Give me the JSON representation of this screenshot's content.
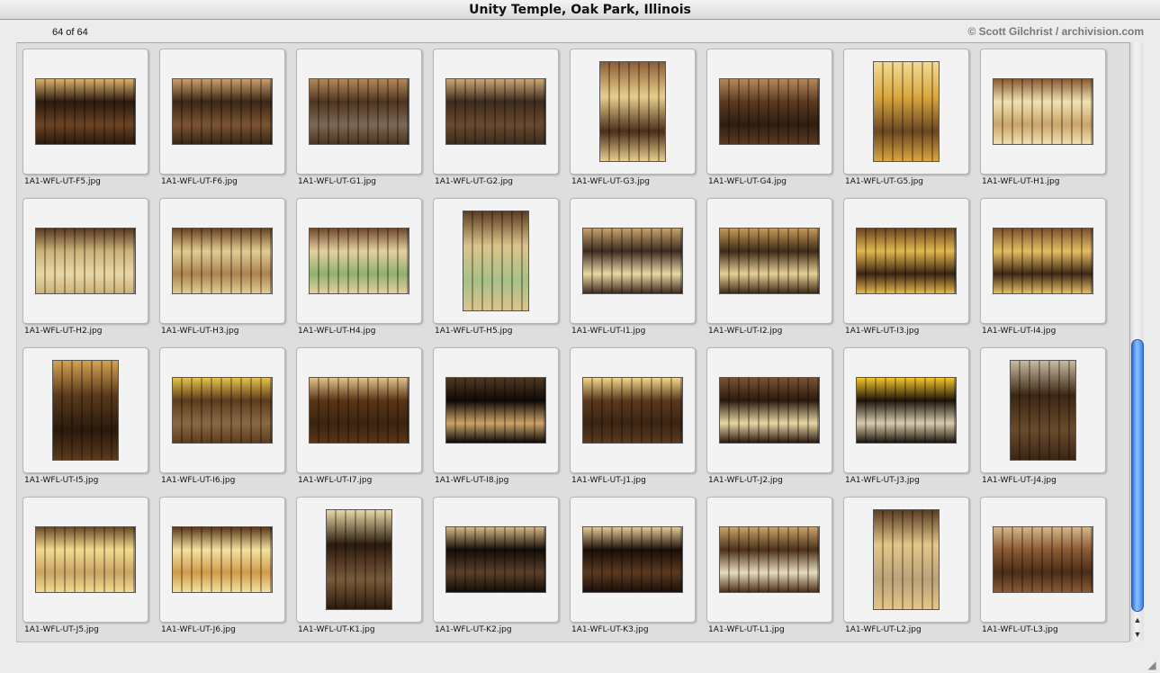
{
  "window": {
    "title": "Unity Temple, Oak Park, Illinois"
  },
  "info": {
    "count": "64 of 64",
    "copyright": "© Scott Gilchrist / archivision.com"
  },
  "thumbnails": [
    {
      "file": "1A1-WFL-UT-F5.jpg",
      "orient": "land",
      "colors": [
        "#2a1a0e",
        "#d9b26a",
        "#6b4424"
      ]
    },
    {
      "file": "1A1-WFL-UT-F6.jpg",
      "orient": "land",
      "colors": [
        "#3a2715",
        "#c8a06a",
        "#7a5533"
      ]
    },
    {
      "file": "1A1-WFL-UT-G1.jpg",
      "orient": "land",
      "colors": [
        "#4e3420",
        "#b28a5a",
        "#7a6a56"
      ]
    },
    {
      "file": "1A1-WFL-UT-G2.jpg",
      "orient": "land",
      "colors": [
        "#3b2b1c",
        "#c9a978",
        "#6a4a30"
      ]
    },
    {
      "file": "1A1-WFL-UT-G3.jpg",
      "orient": "port",
      "colors": [
        "#e8cf8e",
        "#8b5e36",
        "#4b2e18"
      ]
    },
    {
      "file": "1A1-WFL-UT-G4.jpg",
      "orient": "land",
      "colors": [
        "#5a3a20",
        "#b48a5c",
        "#2e1e10"
      ]
    },
    {
      "file": "1A1-WFL-UT-G5.jpg",
      "orient": "port",
      "colors": [
        "#d8a840",
        "#f2dc92",
        "#6a4622"
      ]
    },
    {
      "file": "1A1-WFL-UT-H1.jpg",
      "orient": "land",
      "colors": [
        "#f0e2b0",
        "#8a5a34",
        "#c9a46a"
      ]
    },
    {
      "file": "1A1-WFL-UT-H2.jpg",
      "orient": "land",
      "colors": [
        "#cbb27a",
        "#5a3a22",
        "#e8d8a8"
      ]
    },
    {
      "file": "1A1-WFL-UT-H3.jpg",
      "orient": "land",
      "colors": [
        "#e2cc92",
        "#6a4424",
        "#a98450"
      ]
    },
    {
      "file": "1A1-WFL-UT-H4.jpg",
      "orient": "land",
      "colors": [
        "#e4d0a0",
        "#6e4a2c",
        "#8fb070"
      ]
    },
    {
      "file": "1A1-WFL-UT-H5.jpg",
      "orient": "port",
      "colors": [
        "#dcc48c",
        "#5e3e22",
        "#a6c08a"
      ]
    },
    {
      "file": "1A1-WFL-UT-I1.jpg",
      "orient": "land",
      "colors": [
        "#3c2c1e",
        "#c6a26c",
        "#e8d6a4"
      ]
    },
    {
      "file": "1A1-WFL-UT-I2.jpg",
      "orient": "land",
      "colors": [
        "#3e2a16",
        "#c69a58",
        "#e6cf96"
      ]
    },
    {
      "file": "1A1-WFL-UT-I3.jpg",
      "orient": "land",
      "colors": [
        "#e2b84e",
        "#6a4622",
        "#3a2412"
      ]
    },
    {
      "file": "1A1-WFL-UT-I4.jpg",
      "orient": "land",
      "colors": [
        "#e4be62",
        "#7a5030",
        "#3e2816"
      ]
    },
    {
      "file": "1A1-WFL-UT-I5.jpg",
      "orient": "port",
      "colors": [
        "#5a3a1c",
        "#d4a452",
        "#2a1a0c"
      ]
    },
    {
      "file": "1A1-WFL-UT-I6.jpg",
      "orient": "land",
      "colors": [
        "#5c3c1e",
        "#e6c24a",
        "#8a6a44"
      ]
    },
    {
      "file": "1A1-WFL-UT-I7.jpg",
      "orient": "land",
      "colors": [
        "#5a3414",
        "#e2c48e",
        "#3a2412"
      ]
    },
    {
      "file": "1A1-WFL-UT-I8.jpg",
      "orient": "land",
      "colors": [
        "#0e0806",
        "#4e3a22",
        "#caa468"
      ]
    },
    {
      "file": "1A1-WFL-UT-J1.jpg",
      "orient": "land",
      "colors": [
        "#5a3a1e",
        "#f2d68a",
        "#3a2412"
      ]
    },
    {
      "file": "1A1-WFL-UT-J2.jpg",
      "orient": "land",
      "colors": [
        "#2a1a0e",
        "#7a5432",
        "#e6d6a6"
      ]
    },
    {
      "file": "1A1-WFL-UT-J3.jpg",
      "orient": "land",
      "colors": [
        "#1e140a",
        "#f4c62a",
        "#d8ccae"
      ]
    },
    {
      "file": "1A1-WFL-UT-J4.jpg",
      "orient": "port",
      "colors": [
        "#3a2614",
        "#c6bca0",
        "#6a4a2c"
      ]
    },
    {
      "file": "1A1-WFL-UT-J5.jpg",
      "orient": "land",
      "colors": [
        "#f2dc8e",
        "#6a4a28",
        "#c8a466"
      ]
    },
    {
      "file": "1A1-WFL-UT-J6.jpg",
      "orient": "land",
      "colors": [
        "#f2e2a0",
        "#5a3818",
        "#d09a4a"
      ]
    },
    {
      "file": "1A1-WFL-UT-K1.jpg",
      "orient": "port",
      "colors": [
        "#2a1a0e",
        "#e8d9a8",
        "#7a5a3a"
      ]
    },
    {
      "file": "1A1-WFL-UT-K2.jpg",
      "orient": "land",
      "colors": [
        "#120c08",
        "#d6b886",
        "#5a4028"
      ]
    },
    {
      "file": "1A1-WFL-UT-K3.jpg",
      "orient": "land",
      "colors": [
        "#1a0e08",
        "#e4c896",
        "#5a3a20"
      ]
    },
    {
      "file": "1A1-WFL-UT-L1.jpg",
      "orient": "land",
      "colors": [
        "#4a3018",
        "#c8a46a",
        "#e6dcc0"
      ]
    },
    {
      "file": "1A1-WFL-UT-L2.jpg",
      "orient": "port",
      "colors": [
        "#e2c68a",
        "#5a3e22",
        "#bca27a"
      ]
    },
    {
      "file": "1A1-WFL-UT-L3.jpg",
      "orient": "land",
      "colors": [
        "#8a5a34",
        "#d6b88a",
        "#4a2e18"
      ]
    }
  ],
  "scrollbar": {
    "up_arrow": "▲",
    "down_arrow": "▼",
    "resize": "◢"
  }
}
